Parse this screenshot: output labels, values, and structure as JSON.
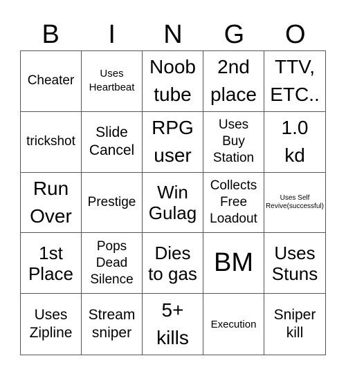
{
  "header": {
    "letters": [
      "B",
      "I",
      "N",
      "G",
      "O"
    ]
  },
  "cells": [
    {
      "text": "Cheater",
      "size": "s-ms"
    },
    {
      "text": "Uses\nHeartbeat",
      "size": "s-s"
    },
    {
      "text": "Noob\ntube",
      "size": "s-xl"
    },
    {
      "text": "2nd\nplace",
      "size": "s-xl"
    },
    {
      "text": "TTV,\nETC..",
      "size": "s-xl"
    },
    {
      "text": "trickshot",
      "size": "s-ms"
    },
    {
      "text": "Slide\nCancel",
      "size": "s-m"
    },
    {
      "text": "RPG\nuser",
      "size": "s-xl"
    },
    {
      "text": "Uses\nBuy\nStation",
      "size": "s-ms"
    },
    {
      "text": "1.0\nkd",
      "size": "s-xl"
    },
    {
      "text": "Run\nOver",
      "size": "s-xl"
    },
    {
      "text": "Prestige",
      "size": "s-ms"
    },
    {
      "text": "Win\nGulag",
      "size": "s-l"
    },
    {
      "text": "Collects\nFree\nLoadout",
      "size": "s-ms"
    },
    {
      "text": "Uses Self\nRevive(successful)",
      "size": "s-tiny"
    },
    {
      "text": "1st\nPlace",
      "size": "s-l"
    },
    {
      "text": "Pops\nDead\nSilence",
      "size": "s-ms"
    },
    {
      "text": "Dies\nto gas",
      "size": "s-l"
    },
    {
      "text": "BM",
      "size": "s-big"
    },
    {
      "text": "Uses\nStuns",
      "size": "s-l"
    },
    {
      "text": "Uses\nZipline",
      "size": "s-m"
    },
    {
      "text": "Stream\nsniper",
      "size": "s-m"
    },
    {
      "text": "5+\nkills",
      "size": "s-xl"
    },
    {
      "text": "Execution",
      "size": "s-ex"
    },
    {
      "text": "Sniper\nkill",
      "size": "s-m"
    }
  ]
}
